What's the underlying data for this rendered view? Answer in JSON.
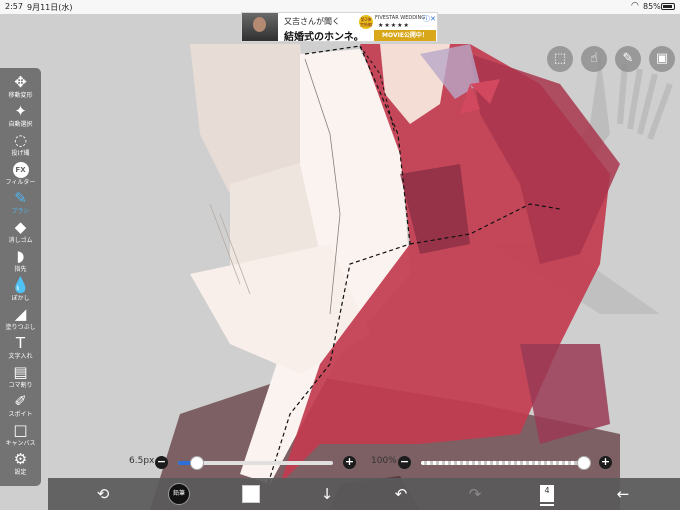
{
  "status_bar": {
    "time": "2:57",
    "date": "9月11日(水)",
    "battery": "85%"
  },
  "ad": {
    "subtitle": "又吉さんが聞く",
    "title": "結婚式のホンネ。",
    "badge": "第2弾 完結編",
    "brand": "FIVESTAR WEDDING",
    "stars": "★★★★★",
    "cta": "MOVIE公開中！"
  },
  "tools": [
    {
      "icon": "✥",
      "label": "移動変形"
    },
    {
      "icon": "✦",
      "label": "自動選択"
    },
    {
      "icon": "◌",
      "label": "投げ縄"
    },
    {
      "icon": "FX",
      "label": "フィルター"
    },
    {
      "icon": "✎",
      "label": "ブラシ"
    },
    {
      "icon": "◆",
      "label": "消しゴム"
    },
    {
      "icon": "◗",
      "label": "指先"
    },
    {
      "icon": "💧",
      "label": "ぼかし"
    },
    {
      "icon": "◢",
      "label": "塗りつぶし"
    },
    {
      "icon": "T",
      "label": "文字入れ"
    },
    {
      "icon": "▤",
      "label": "コマ割り"
    },
    {
      "icon": "✐",
      "label": "スポイト"
    },
    {
      "icon": "□",
      "label": "キャンバス"
    },
    {
      "icon": "⚙",
      "label": "設定"
    }
  ],
  "top_tools": [
    "selection-icon",
    "hand-icon",
    "ruler-icon",
    "image-icon"
  ],
  "brush": {
    "size_label": "6.5px",
    "size_fraction": 0.12,
    "opacity_label": "100%",
    "opacity_fraction": 1.0,
    "minus": "−",
    "plus": "+"
  },
  "bottom": {
    "transform_icon": "⟲",
    "brush_icon_label": "鉛筆",
    "download_icon": "↓",
    "undo_icon": "↶",
    "redo_icon": "↷",
    "layer_count": "4",
    "back_icon": "←"
  },
  "colors": {
    "accent": "#4fb5ee",
    "slider_fill": "#2c6fd6",
    "red_jacket": "#c23c4f"
  }
}
